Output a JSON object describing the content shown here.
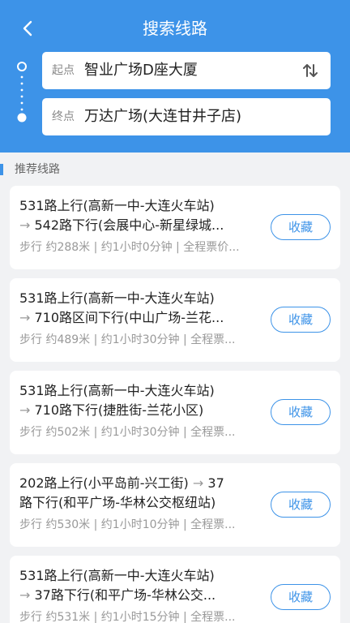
{
  "header": {
    "title": "搜索线路"
  },
  "search": {
    "from_label": "起点",
    "from_value": "智业广场D座大厦",
    "to_label": "终点",
    "to_value": "万达广场(大连甘井子店)"
  },
  "section": {
    "title": "推荐线路"
  },
  "routes": [
    {
      "line1": "531路上行(高新一中-大连火车站)",
      "arrow": "→",
      "line2": "542路下行(会展中心-新星绿城...",
      "meta": "步行 约288米 | 约1小时0分钟 | 全程票价...",
      "button": "收藏"
    },
    {
      "line1": "531路上行(高新一中-大连火车站)",
      "arrow": "→",
      "line2": "710路区间下行(中山广场-兰花...",
      "meta": "步行 约489米 | 约1小时30分钟 | 全程票...",
      "button": "收藏"
    },
    {
      "line1": "531路上行(高新一中-大连火车站)",
      "arrow": "→",
      "line2": "710路下行(捷胜街-兰花小区)",
      "meta": "步行 约502米 | 约1小时30分钟 | 全程票...",
      "button": "收藏"
    },
    {
      "line1": "202路上行(小平岛前-兴工街)",
      "arrow": "→",
      "line1_tail": "37",
      "line2": "路下行(和平广场-华林公交枢纽站)",
      "meta": "步行 约530米 | 约1小时10分钟 | 全程票...",
      "button": "收藏"
    },
    {
      "line1": "531路上行(高新一中-大连火车站)",
      "arrow": "→",
      "line2": "37路下行(和平广场-华林公交...",
      "meta": "步行 约531米 | 约1小时15分钟 | 全程票...",
      "button": "收藏"
    }
  ],
  "colors": {
    "primary": "#3d93e8",
    "background": "#f1f2f4"
  }
}
